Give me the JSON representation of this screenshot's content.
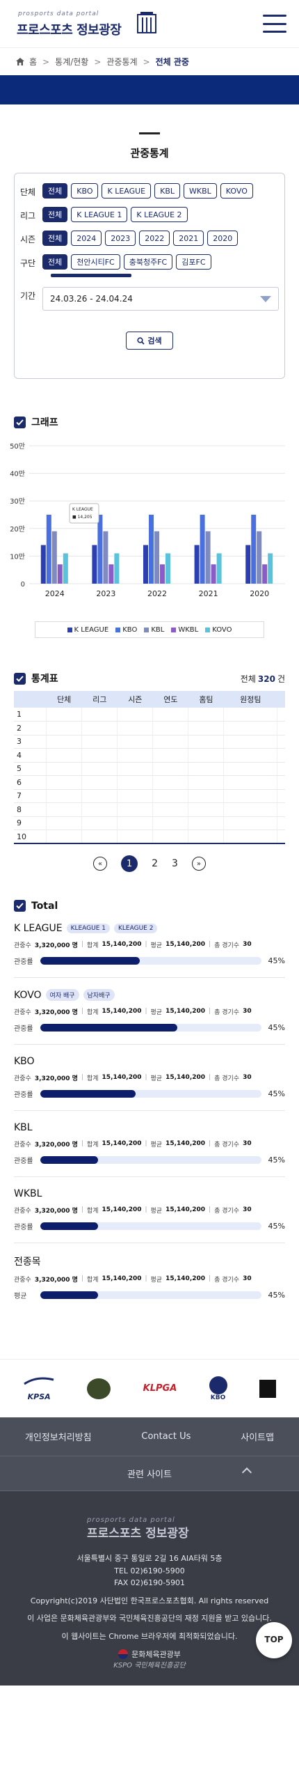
{
  "header": {
    "logo_sub": "prosports data portal",
    "logo_main": "프로스포츠 정보광장"
  },
  "breadcrumb": {
    "items": [
      "홈",
      "통계/현황",
      "관중통계"
    ],
    "current": "전체 관중"
  },
  "page_title": "관중통계",
  "filters": {
    "sport": {
      "label": "단체",
      "options": [
        "전체",
        "KBO",
        "K LEAGUE",
        "KBL",
        "WKBL",
        "KOVO"
      ],
      "selected": "전체"
    },
    "league": {
      "label": "리그",
      "options": [
        "전체",
        "K LEAGUE 1",
        "K LEAGUE 2"
      ],
      "selected": "전체"
    },
    "season": {
      "label": "시즌",
      "options": [
        "전체",
        "2024",
        "2023",
        "2022",
        "2021",
        "2020"
      ],
      "selected": "전체"
    },
    "team": {
      "label": "구단",
      "options": [
        "전체",
        "천안시티FC",
        "충북청주FC",
        "김포FC"
      ],
      "selected": "전체"
    },
    "period": {
      "label": "기간",
      "value": "24.03.26 - 24.04.24"
    },
    "search_label": "검색"
  },
  "graph": {
    "title": "그래프",
    "tooltip": {
      "line1": "K LEAGUE",
      "line2": "■ 14,205"
    }
  },
  "chart_data": {
    "type": "bar",
    "categories": [
      "2024",
      "2023",
      "2022",
      "2021",
      "2020"
    ],
    "ylim": [
      0,
      50
    ],
    "yticks": [
      "0",
      "10만",
      "20만",
      "30만",
      "40만",
      "50만"
    ],
    "series": [
      {
        "name": "K LEAGUE",
        "color": "#2b3fb0",
        "values": [
          14,
          14,
          14,
          14,
          14
        ]
      },
      {
        "name": "KBO",
        "color": "#4a70e0",
        "values": [
          25,
          25,
          25,
          25,
          25
        ]
      },
      {
        "name": "KBL",
        "color": "#7f8ac0",
        "values": [
          19,
          19,
          19,
          19,
          19
        ]
      },
      {
        "name": "WKBL",
        "color": "#8a5cc8",
        "values": [
          7,
          7,
          7,
          7,
          7
        ]
      },
      {
        "name": "KOVO",
        "color": "#5ac2da",
        "values": [
          11,
          11,
          11,
          11,
          11
        ]
      }
    ]
  },
  "stats_table": {
    "title": "통계표",
    "total_prefix": "전체",
    "total_count": "320",
    "total_unit": "건",
    "columns": [
      "",
      "단체",
      "리그",
      "시즌",
      "연도",
      "홈팀",
      "원정팀",
      ""
    ],
    "rows": [
      "1",
      "2",
      "3",
      "4",
      "5",
      "6",
      "7",
      "8",
      "9",
      "10"
    ]
  },
  "pagination": {
    "prev": "«",
    "pages": [
      "1",
      "2",
      "3"
    ],
    "current": "1",
    "next": "»"
  },
  "total": {
    "title": "Total",
    "labels": {
      "attend": "관중수",
      "sum": "합계",
      "avg": "평균",
      "games": "총 경기수",
      "rate": "관중률",
      "avg_rate": "평균"
    },
    "sections": [
      {
        "name": "K LEAGUE",
        "tags": [
          "KLEAGUE 1",
          "KLEAGUE 2"
        ],
        "attend": "3,320,000 명",
        "sum": "15,140,200",
        "avg": "15,140,200",
        "games": "30",
        "rate_label": "관중률",
        "rate": 0.45,
        "rate_text": "45%"
      },
      {
        "name": "KOVO",
        "tags": [
          "여자 배구",
          "남자배구"
        ],
        "attend": "3,320,000 명",
        "sum": "15,140,200",
        "avg": "15,140,200",
        "games": "30",
        "rate_label": "관중률",
        "rate": 0.62,
        "rate_text": "45%"
      },
      {
        "name": "KBO",
        "tags": [],
        "attend": "3,320,000 명",
        "sum": "15,140,200",
        "avg": "15,140,200",
        "games": "30",
        "rate_label": "관중률",
        "rate": 0.43,
        "rate_text": "45%"
      },
      {
        "name": "KBL",
        "tags": [],
        "attend": "3,320,000 명",
        "sum": "15,140,200",
        "avg": "15,140,200",
        "games": "30",
        "rate_label": "관중률",
        "rate": 0.26,
        "rate_text": "45%"
      },
      {
        "name": "WKBL",
        "tags": [],
        "attend": "3,320,000 명",
        "sum": "15,140,200",
        "avg": "15,140,200",
        "games": "30",
        "rate_label": "관중률",
        "rate": 0.26,
        "rate_text": "45%"
      },
      {
        "name": "전종목",
        "tags": [],
        "attend": "3,320,000 명",
        "sum": "15,140,200",
        "avg": "15,140,200",
        "games": "30",
        "rate_label": "평균",
        "rate": 0.26,
        "rate_text": "45%"
      }
    ]
  },
  "sponsors": [
    "KPSA",
    "KLPGA",
    "KBO"
  ],
  "footer": {
    "links": [
      "개인정보처리방침",
      "Contact Us",
      "사이트맵"
    ],
    "related": "관련 사이트",
    "logo_sub": "prosports data portal",
    "logo_main": "프로스포츠 정보광장",
    "address": "서울특별시 중구 통일로 2길 16 AIA타워 5층",
    "tel": "TEL 02)6190-5900",
    "fax": "FAX 02)6190-5901",
    "copyright": "Copyright(c)2019 사단법인 한국프로스포츠협회. All rights reserved",
    "notice": "이 사업은 문화체육관광부와 국민체육진흥공단의 재정 지원을 받고 있습니다.",
    "browser": "이 웹사이트는 Chrome 브라우저에 최적화되었습니다.",
    "ministry": "문화체육관광부",
    "kspo": "KSPO 국민체육진흥공단",
    "top_label": "TOP"
  }
}
